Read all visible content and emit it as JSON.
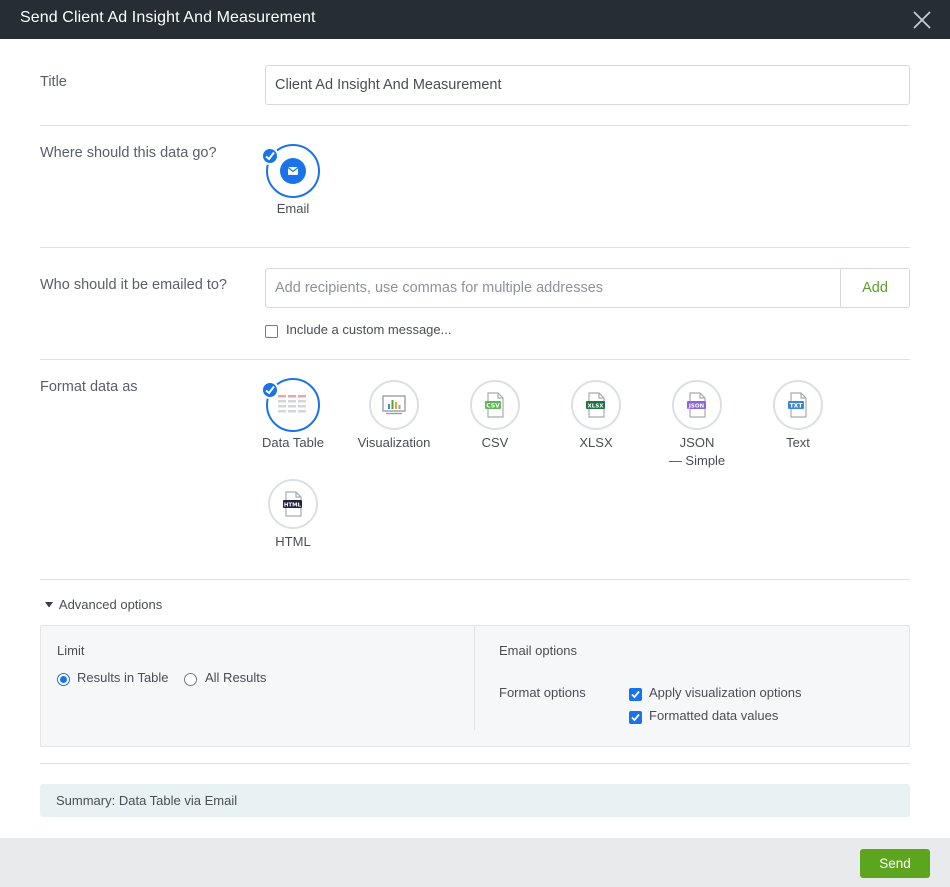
{
  "dialog": {
    "title": "Send Client Ad Insight And Measurement",
    "close_icon": "close-icon"
  },
  "title_field": {
    "label": "Title",
    "value": "Client Ad Insight And Measurement"
  },
  "destination": {
    "label": "Where should this data go?",
    "options": [
      {
        "label": "Email",
        "icon": "email-icon",
        "selected": true
      }
    ]
  },
  "recipients": {
    "label": "Who should it be emailed to?",
    "placeholder": "Add recipients, use commas for multiple addresses",
    "value": "",
    "add_label": "Add",
    "custom_message_label": "Include a custom message..."
  },
  "format": {
    "label": "Format data as",
    "options": [
      {
        "label": "Data Table",
        "icon": "data-table-icon",
        "selected": true
      },
      {
        "label": "Visualization",
        "icon": "visualization-icon",
        "selected": false
      },
      {
        "label": "CSV",
        "icon": "csv-file-icon",
        "selected": false
      },
      {
        "label": "XLSX",
        "icon": "xlsx-file-icon",
        "selected": false
      },
      {
        "label": "JSON",
        "sublabel": "— Simple",
        "icon": "json-file-icon",
        "selected": false
      },
      {
        "label": "Text",
        "icon": "text-file-icon",
        "selected": false
      },
      {
        "label": "HTML",
        "icon": "html-file-icon",
        "selected": false
      }
    ]
  },
  "advanced": {
    "toggle_label": "Advanced options",
    "expanded": true,
    "limit": {
      "label": "Limit",
      "options": [
        {
          "label": "Results in Table",
          "selected": true
        },
        {
          "label": "All Results",
          "selected": false
        }
      ]
    },
    "email_options": {
      "label": "Email options",
      "format_options_label": "Format options",
      "checkboxes": [
        {
          "label": "Apply visualization options",
          "checked": true
        },
        {
          "label": "Formatted data values",
          "checked": true
        }
      ]
    }
  },
  "summary": "Summary: Data Table via Email",
  "footer": {
    "send_label": "Send"
  },
  "colors": {
    "header_bg": "#262d33",
    "accent_blue": "#1a73e8",
    "send_green": "#5ea51f",
    "add_green": "#5aa02c",
    "summary_bg": "#e8f2f3",
    "footer_bg": "#e9eaec"
  }
}
